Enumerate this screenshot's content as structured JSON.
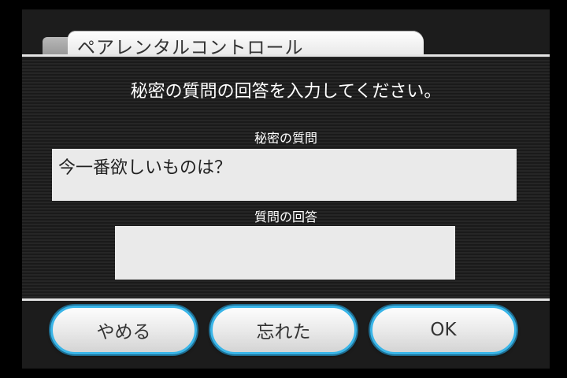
{
  "header": {
    "title": "ペアレンタルコントロール"
  },
  "main": {
    "instruction": "秘密の質問の回答を入力してください。",
    "question_label": "秘密の質問",
    "question_text": "今一番欲しいものは？",
    "answer_label": "質問の回答",
    "answer_value": ""
  },
  "buttons": {
    "cancel": "やめる",
    "forgot": "忘れた",
    "ok": "OK"
  },
  "colors": {
    "button_border": "#39b5e8",
    "field_background": "#eaeaea"
  }
}
